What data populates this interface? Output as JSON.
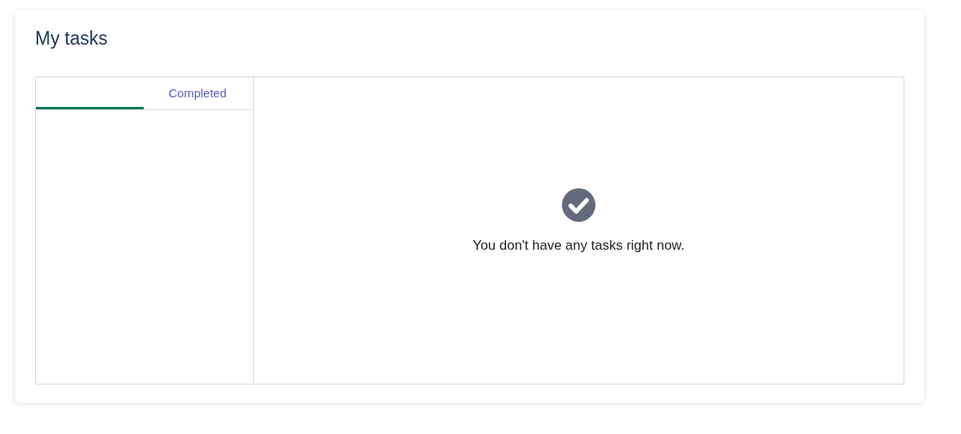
{
  "title": "My tasks",
  "tabs": [
    {
      "selected": true
    },
    {
      "label": "Completed",
      "selected": false
    }
  ],
  "empty_state": {
    "message": "You don't have any tasks right now."
  }
}
